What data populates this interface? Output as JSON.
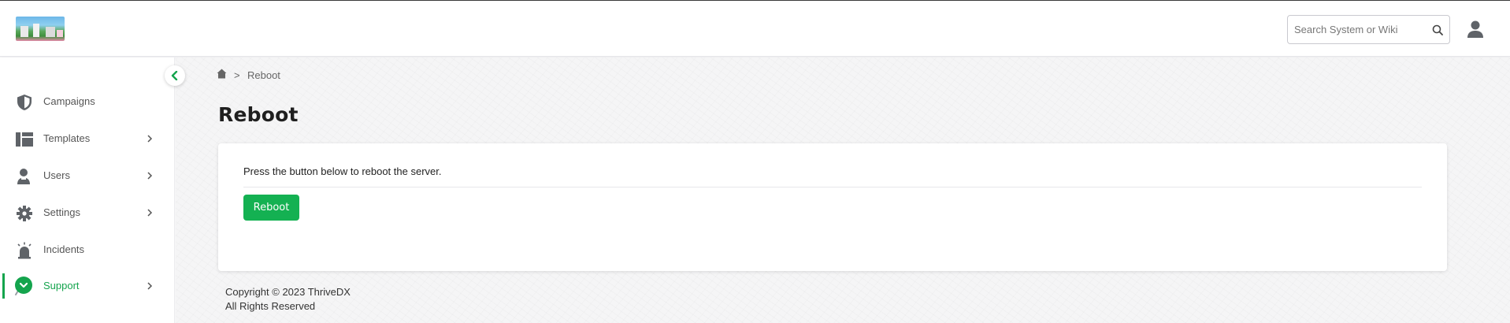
{
  "header": {
    "search_placeholder": "Search System or Wiki"
  },
  "sidebar": {
    "items": [
      {
        "label": "Campaigns",
        "icon": "shield-icon",
        "has_submenu": false,
        "active": false
      },
      {
        "label": "Templates",
        "icon": "templates-icon",
        "has_submenu": true,
        "active": false
      },
      {
        "label": "Users",
        "icon": "users-icon",
        "has_submenu": true,
        "active": false
      },
      {
        "label": "Settings",
        "icon": "gear-icon",
        "has_submenu": true,
        "active": false
      },
      {
        "label": "Incidents",
        "icon": "alarm-icon",
        "has_submenu": false,
        "active": false
      },
      {
        "label": "Support",
        "icon": "support-icon",
        "has_submenu": true,
        "active": true
      }
    ]
  },
  "breadcrumb": {
    "separator": ">",
    "current": "Reboot"
  },
  "page": {
    "title": "Reboot",
    "description": "Press the button below to reboot the server.",
    "button_label": "Reboot"
  },
  "footer": {
    "copyright": "Copyright © 2023 ThriveDX",
    "rights": "All Rights Reserved"
  },
  "colors": {
    "accent": "#14b152",
    "active_text": "#14a44d",
    "icon_gray": "#5f6368"
  }
}
